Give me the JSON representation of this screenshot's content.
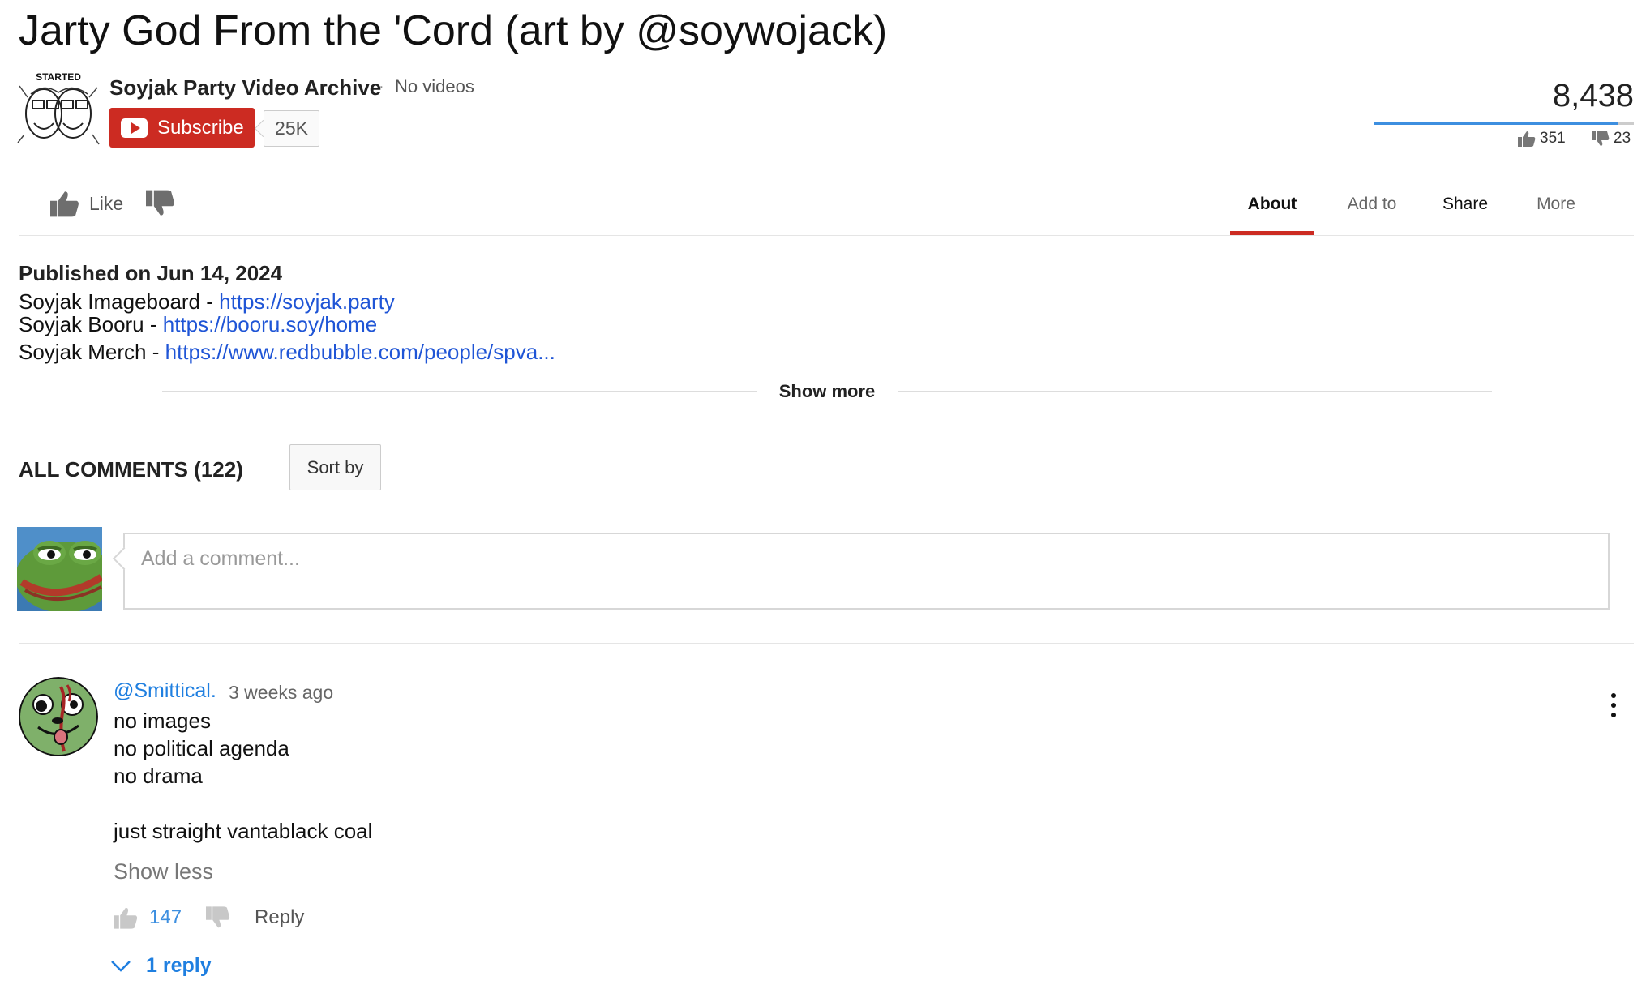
{
  "video": {
    "title": "Jarty God From the 'Cord (art by @soywojack)",
    "views": "8,438",
    "likes": "351",
    "dislikes": "23",
    "like_ratio": 0.94
  },
  "channel": {
    "avatar_text": "STARTED",
    "name": "Soyjak Party Video Archive",
    "separator": "·",
    "videos_label": "No videos",
    "subscribe_label": "Subscribe",
    "subscriber_count": "25K"
  },
  "actions": {
    "like_label": "Like"
  },
  "tabs": [
    {
      "label": "About"
    },
    {
      "label": "Add to"
    },
    {
      "label": "Share"
    },
    {
      "label": "More"
    }
  ],
  "description": {
    "published": "Published on Jun 14, 2024",
    "lines": [
      {
        "prefix": "Soyjak Imageboard - ",
        "link": "https://soyjak.party"
      },
      {
        "prefix": "Soyjak Booru - ",
        "link": "https://booru.soy/home"
      },
      {
        "prefix": "Soyjak Merch - ",
        "link": "https://www.redbubble.com/people/spva..."
      }
    ],
    "show_more": "Show more"
  },
  "comments": {
    "header": "ALL COMMENTS (122)",
    "sort_label": "Sort by",
    "input_placeholder": "Add a comment...",
    "items": [
      {
        "author": "@Smittical.",
        "time": "3 weeks ago",
        "lines": [
          "no images",
          "no political agenda",
          "no drama",
          "",
          "just straight vantablack coal"
        ],
        "show_less": "Show less",
        "likes": "147",
        "reply_label": "Reply",
        "replies_label": "1 reply"
      }
    ]
  },
  "colors": {
    "subscribe": "#cc2b22",
    "link": "#1f55d6",
    "author": "#1f7fe0",
    "like_bar": "#3d8fe0",
    "active_tab": "#cc2b22"
  }
}
